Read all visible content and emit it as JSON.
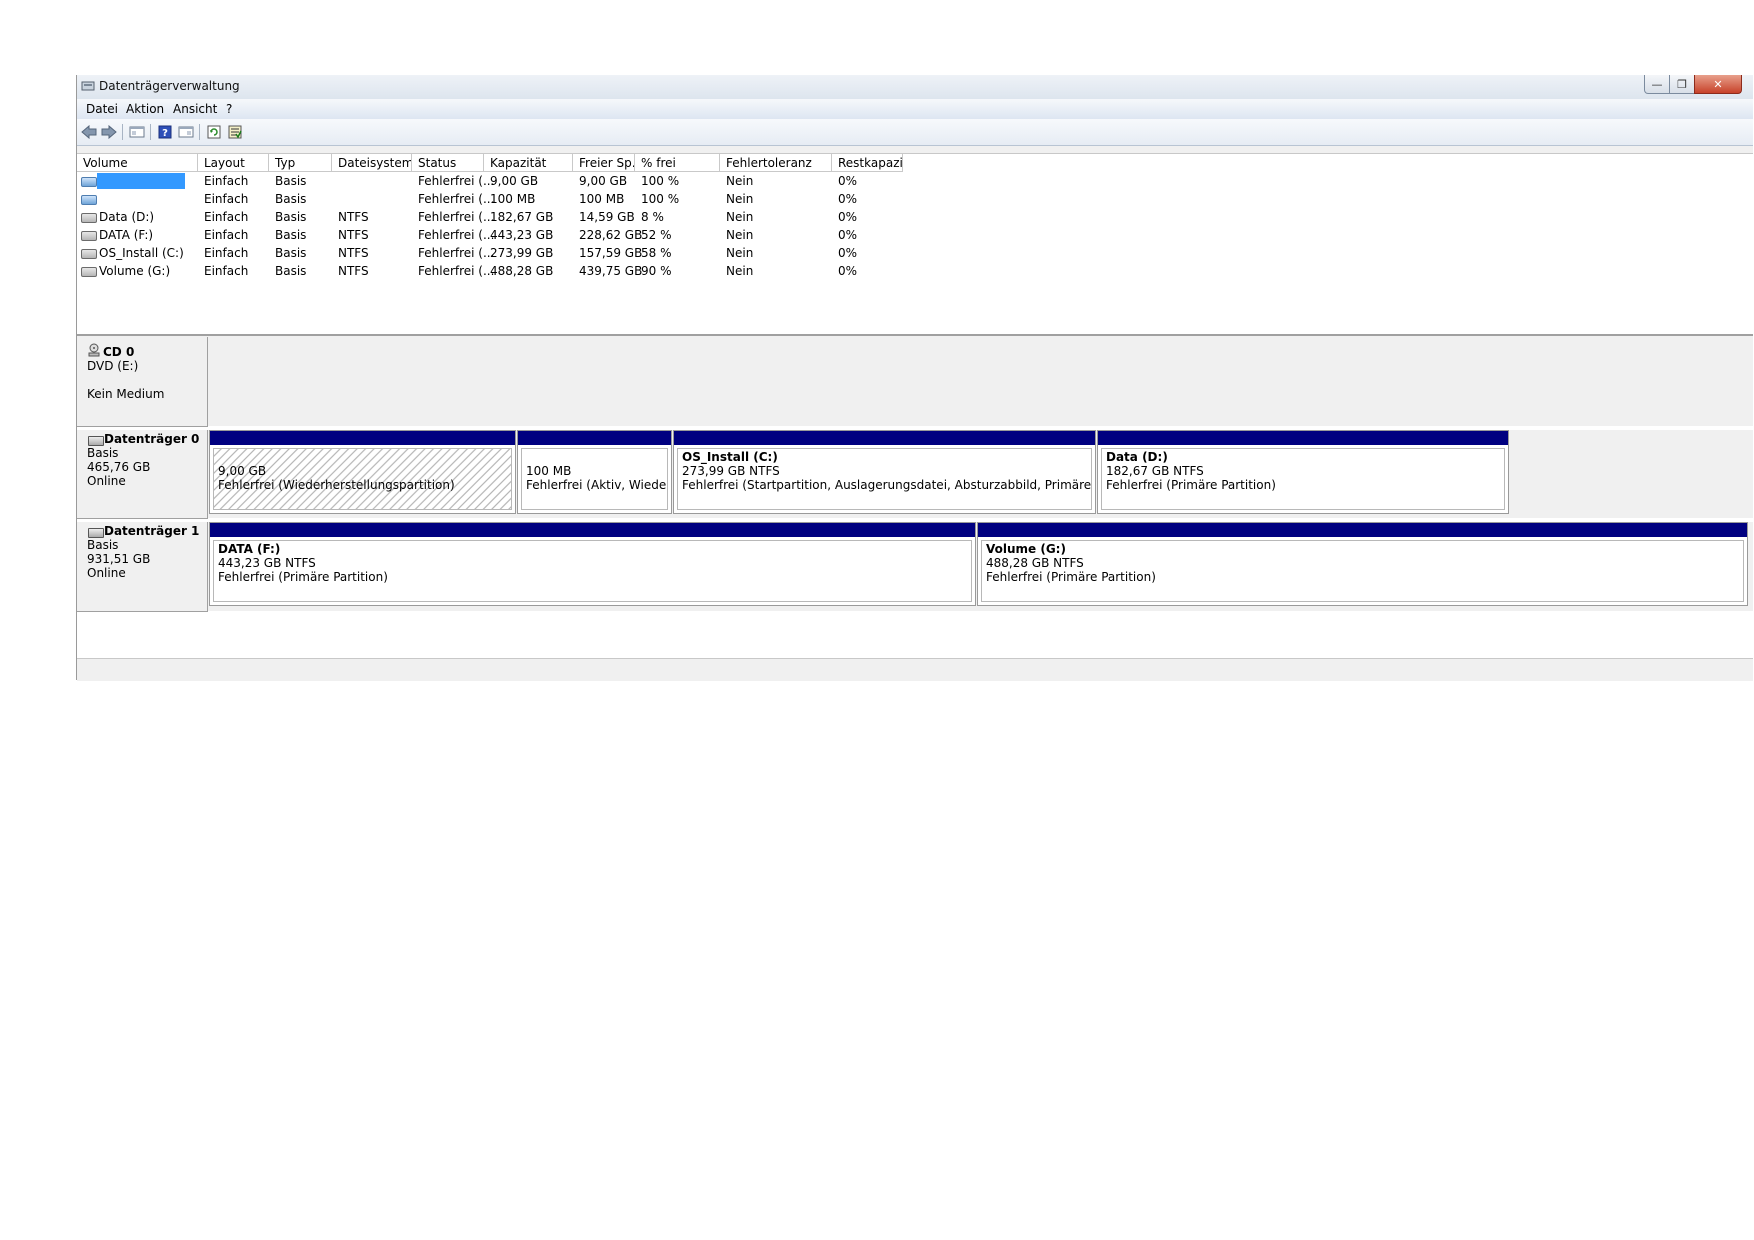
{
  "window": {
    "title": "Datenträgerverwaltung"
  },
  "menu": [
    "Datei",
    "Aktion",
    "Ansicht",
    "?"
  ],
  "volume_table": {
    "columns": [
      "Volume",
      "Layout",
      "Typ",
      "Dateisystem",
      "Status",
      "Kapazität",
      "Freier Sp...",
      "% frei",
      "Fehlertoleranz",
      "Restkapazi..."
    ],
    "rows": [
      {
        "volume": "",
        "layout": "Einfach",
        "typ": "Basis",
        "fs": "",
        "status": "Fehlerfrei (...",
        "capacity": "9,00 GB",
        "free": "9,00 GB",
        "pct": "100 %",
        "fault": "Nein",
        "overhead": "0%"
      },
      {
        "volume": "",
        "layout": "Einfach",
        "typ": "Basis",
        "fs": "",
        "status": "Fehlerfrei (...",
        "capacity": "100 MB",
        "free": "100 MB",
        "pct": "100 %",
        "fault": "Nein",
        "overhead": "0%"
      },
      {
        "volume": "Data (D:)",
        "layout": "Einfach",
        "typ": "Basis",
        "fs": "NTFS",
        "status": "Fehlerfrei (...",
        "capacity": "182,67 GB",
        "free": "14,59 GB",
        "pct": "8 %",
        "fault": "Nein",
        "overhead": "0%"
      },
      {
        "volume": "DATA (F:)",
        "layout": "Einfach",
        "typ": "Basis",
        "fs": "NTFS",
        "status": "Fehlerfrei (...",
        "capacity": "443,23 GB",
        "free": "228,62 GB",
        "pct": "52 %",
        "fault": "Nein",
        "overhead": "0%"
      },
      {
        "volume": "OS_Install (C:)",
        "layout": "Einfach",
        "typ": "Basis",
        "fs": "NTFS",
        "status": "Fehlerfrei (...",
        "capacity": "273,99 GB",
        "free": "157,59 GB",
        "pct": "58 %",
        "fault": "Nein",
        "overhead": "0%"
      },
      {
        "volume": "Volume (G:)",
        "layout": "Einfach",
        "typ": "Basis",
        "fs": "NTFS",
        "status": "Fehlerfrei (...",
        "capacity": "488,28 GB",
        "free": "439,75 GB",
        "pct": "90 %",
        "fault": "Nein",
        "overhead": "0%"
      }
    ]
  },
  "cd0": {
    "name": "CD 0",
    "drive": "DVD (E:)",
    "media": "Kein Medium"
  },
  "disk0": {
    "name": "Datenträger 0",
    "type": "Basis",
    "size": "465,76 GB",
    "state": "Online",
    "partitions": [
      {
        "title": "",
        "size": "9,00 GB",
        "status": "Fehlerfrei (Wiederherstellungspartition)"
      },
      {
        "title": "",
        "size": "100 MB",
        "status": "Fehlerfrei (Aktiv, Wiederherst"
      },
      {
        "title": "OS_Install  (C:)",
        "size": "273,99 GB NTFS",
        "status": "Fehlerfrei (Startpartition, Auslagerungsdatei, Absturzabbild, Primäre Partition)"
      },
      {
        "title": "Data  (D:)",
        "size": "182,67 GB NTFS",
        "status": "Fehlerfrei (Primäre Partition)"
      }
    ]
  },
  "disk1": {
    "name": "Datenträger 1",
    "type": "Basis",
    "size": "931,51 GB",
    "state": "Online",
    "partitions": [
      {
        "title": "DATA  (F:)",
        "size": "443,23 GB NTFS",
        "status": "Fehlerfrei (Primäre Partition)"
      },
      {
        "title": "Volume  (G:)",
        "size": "488,28 GB NTFS",
        "status": "Fehlerfrei (Primäre Partition)"
      }
    ]
  }
}
